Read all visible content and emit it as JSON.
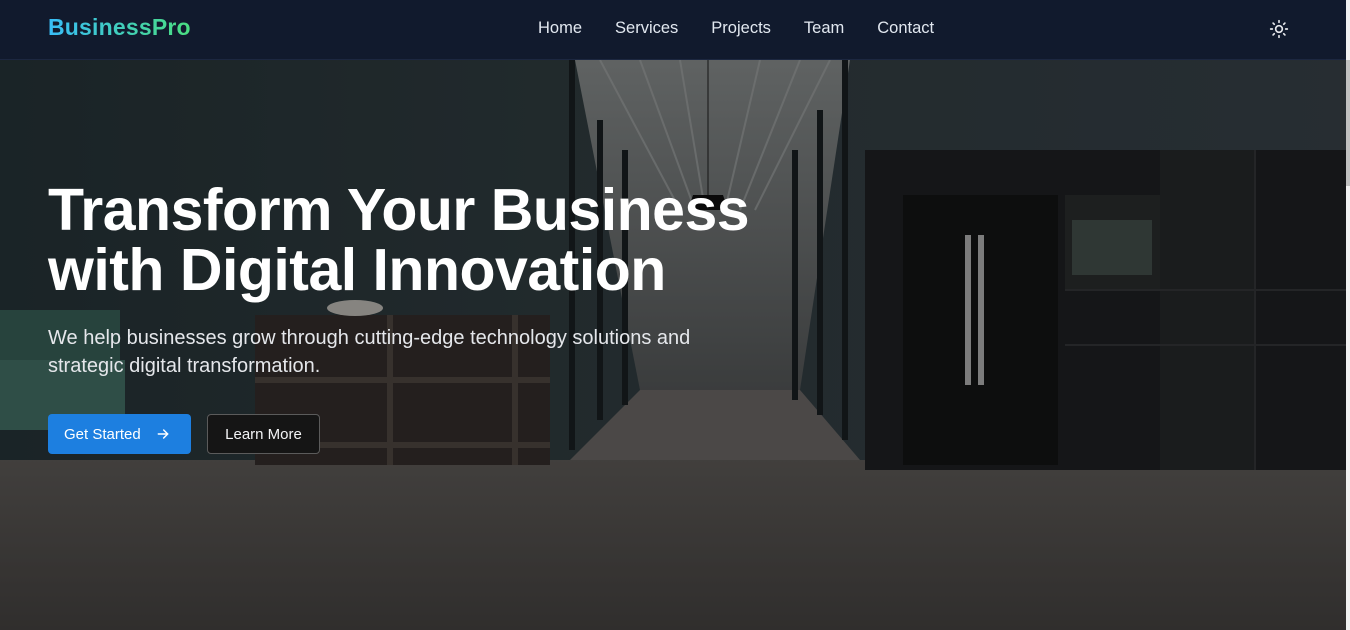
{
  "header": {
    "brand": "BusinessPro",
    "nav": [
      {
        "label": "Home"
      },
      {
        "label": "Services"
      },
      {
        "label": "Projects"
      },
      {
        "label": "Team"
      },
      {
        "label": "Contact"
      }
    ],
    "theme_icon": "sun-icon"
  },
  "hero": {
    "title_line1": "Transform Your Business",
    "title_line2": "with Digital Innovation",
    "subtitle_line1": "We help businesses grow through cutting-edge technology solutions and",
    "subtitle_line2": "strategic digital transformation.",
    "primary_cta": "Get Started",
    "primary_cta_icon": "arrow-right-icon",
    "secondary_cta": "Learn More"
  },
  "colors": {
    "header_bg": "#111a2d",
    "brand_gradient_start": "#38bdf8",
    "brand_gradient_end": "#4ade80",
    "primary_button": "#1d7fe0"
  }
}
